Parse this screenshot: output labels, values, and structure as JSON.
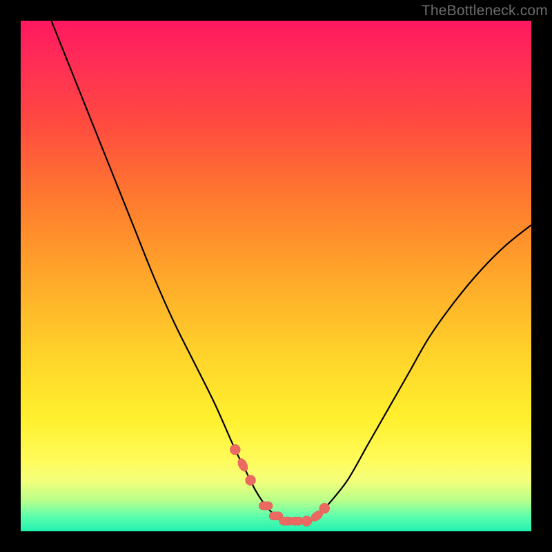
{
  "watermark": "TheBottleneck.com",
  "chart_data": {
    "type": "line",
    "title": "",
    "xlabel": "",
    "ylabel": "",
    "xlim": [
      0,
      100
    ],
    "ylim": [
      0,
      100
    ],
    "grid": false,
    "legend": false,
    "series": [
      {
        "name": "bottleneck-curve",
        "x": [
          6,
          10,
          14,
          18,
          22,
          26,
          30,
          34,
          38,
          42,
          44,
          46,
          48,
          50,
          52,
          54,
          56,
          58,
          60,
          64,
          68,
          72,
          76,
          80,
          85,
          90,
          95,
          100
        ],
        "y": [
          100,
          90,
          80,
          70,
          60,
          50,
          41,
          33,
          25,
          16,
          12,
          8,
          5,
          3,
          2,
          2,
          2,
          3,
          5,
          10,
          17,
          24,
          31,
          38,
          45,
          51,
          56,
          60
        ]
      }
    ],
    "markers": {
      "name": "highlight-dots",
      "x": [
        42,
        43.5,
        45,
        48,
        50,
        52,
        54,
        56,
        58,
        59.5
      ],
      "shape": [
        "circle",
        "tilted",
        "circle",
        "pill",
        "pill",
        "pill",
        "pill",
        "circle",
        "tilted",
        "circle"
      ]
    },
    "gradient_stops": [
      {
        "pos": 0,
        "color": "#ff1860"
      },
      {
        "pos": 20,
        "color": "#ff4a40"
      },
      {
        "pos": 50,
        "color": "#ffa72a"
      },
      {
        "pos": 78,
        "color": "#fff02e"
      },
      {
        "pos": 100,
        "color": "#21f0b0"
      }
    ]
  }
}
